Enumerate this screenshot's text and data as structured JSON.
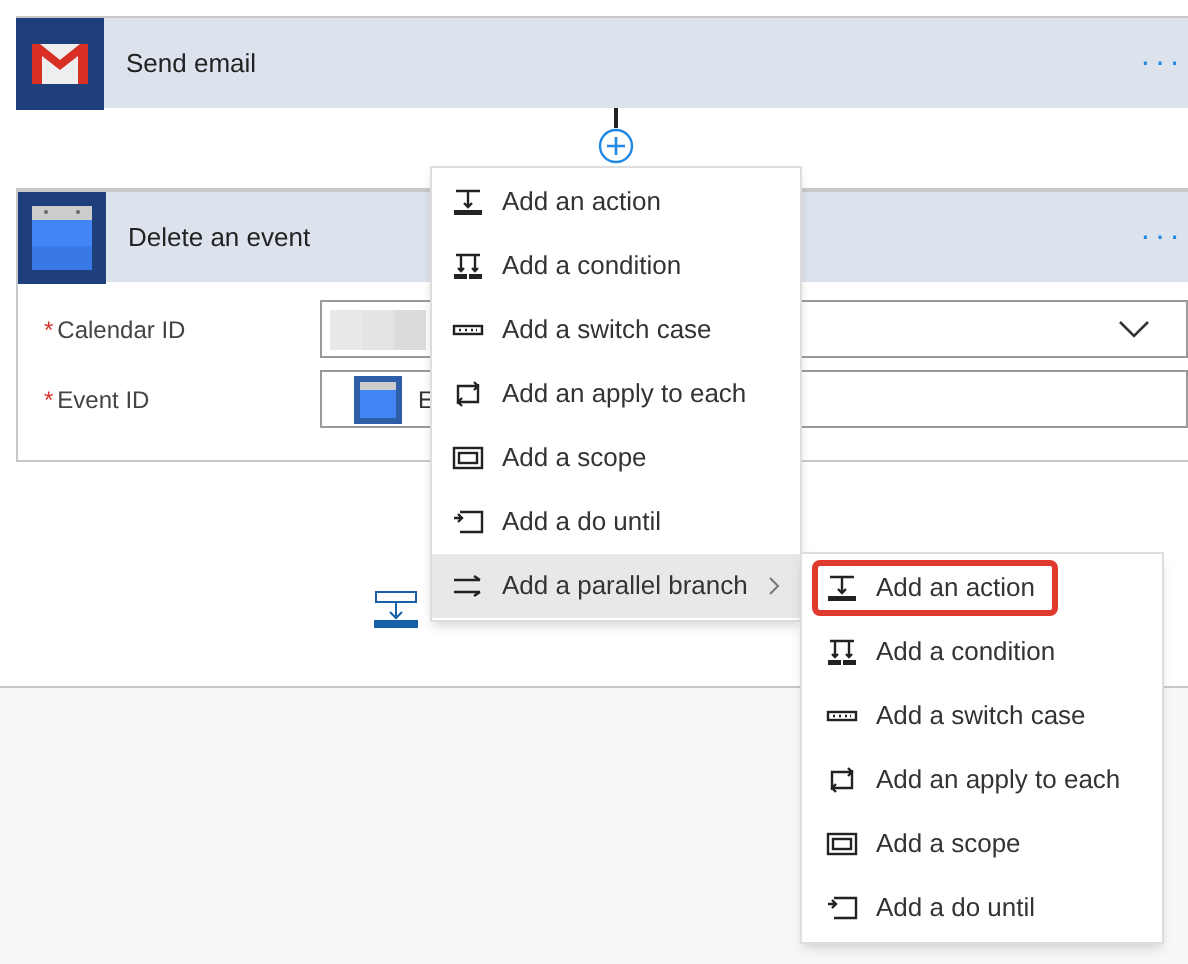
{
  "cards": [
    {
      "title": "Send email",
      "kind": "mail",
      "more": "···"
    },
    {
      "title": "Delete an event",
      "kind": "calendar",
      "more": "···",
      "fields": [
        {
          "required_mark": "*",
          "label": "Calendar ID",
          "kind": "dropdown"
        },
        {
          "required_mark": "*",
          "label": "Event ID",
          "kind": "token",
          "token_text": "E"
        }
      ]
    }
  ],
  "menu": {
    "items": [
      {
        "label": "Add an action",
        "kind": "action",
        "active": false,
        "submenu": false
      },
      {
        "label": "Add a condition",
        "kind": "condition",
        "active": false,
        "submenu": false
      },
      {
        "label": "Add a switch case",
        "kind": "switch",
        "active": false,
        "submenu": false
      },
      {
        "label": "Add an apply to each",
        "kind": "foreach",
        "active": false,
        "submenu": false
      },
      {
        "label": "Add a scope",
        "kind": "scope",
        "active": false,
        "submenu": false
      },
      {
        "label": "Add a do until",
        "kind": "until",
        "active": false,
        "submenu": false
      },
      {
        "label": "Add a parallel branch",
        "kind": "parallel",
        "active": true,
        "submenu": true
      }
    ]
  },
  "submenu": {
    "items": [
      {
        "label": "Add an action",
        "kind": "action",
        "highlighted": true
      },
      {
        "label": "Add a condition",
        "kind": "condition",
        "highlighted": false
      },
      {
        "label": "Add a switch case",
        "kind": "switch",
        "highlighted": false
      },
      {
        "label": "Add an apply to each",
        "kind": "foreach",
        "highlighted": false
      },
      {
        "label": "Add a scope",
        "kind": "scope",
        "highlighted": false
      },
      {
        "label": "Add a do until",
        "kind": "until",
        "highlighted": false
      }
    ]
  }
}
